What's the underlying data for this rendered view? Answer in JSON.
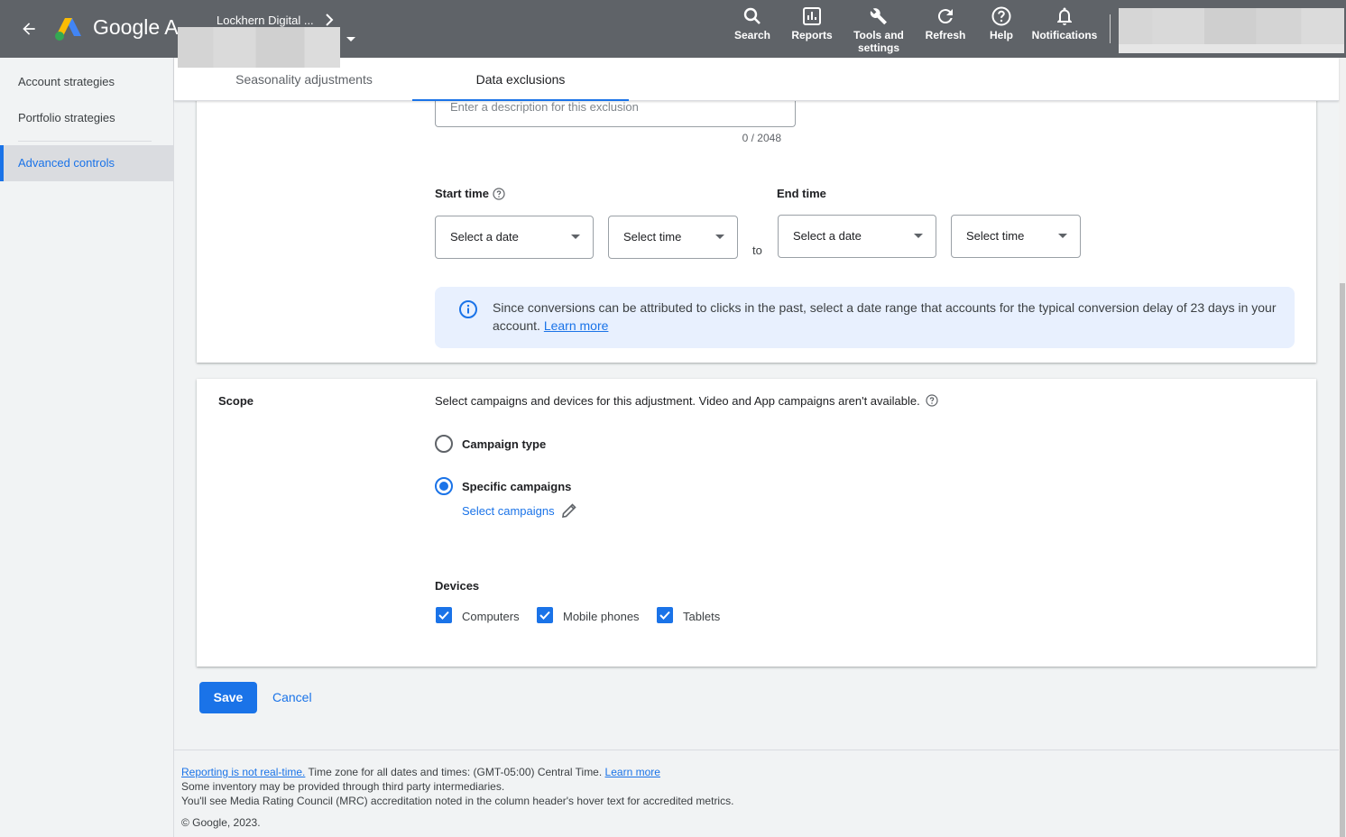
{
  "header": {
    "brand": "Google Ads",
    "account_name": "Lockhern Digital ...",
    "tools": [
      {
        "label": "Search",
        "icon": "search-icon"
      },
      {
        "label": "Reports",
        "icon": "reports-icon"
      },
      {
        "label": "Tools and settings",
        "icon": "wrench-icon"
      },
      {
        "label": "Refresh",
        "icon": "refresh-icon"
      },
      {
        "label": "Help",
        "icon": "help-icon"
      },
      {
        "label": "Notifications",
        "icon": "bell-icon"
      }
    ]
  },
  "sidebar": {
    "items": [
      {
        "label": "Account strategies"
      },
      {
        "label": "Portfolio strategies"
      },
      {
        "label": "Advanced controls"
      }
    ]
  },
  "tabs": [
    {
      "label": "Seasonality adjustments"
    },
    {
      "label": "Data exclusions"
    }
  ],
  "form": {
    "description_placeholder": "Enter a description for this exclusion",
    "char_count": "0 / 2048",
    "start_time_label": "Start time",
    "end_time_label": "End time",
    "start_date_placeholder": "Select a date",
    "start_time_placeholder": "Select time",
    "to_label": "to",
    "end_date_placeholder": "Select a date",
    "end_time_placeholder": "Select time",
    "info_text": "Since conversions can be attributed to clicks in the past, select a date range that accounts for the typical conversion delay of 23 days in your account.",
    "info_link": "Learn more"
  },
  "scope": {
    "label": "Scope",
    "description": "Select campaigns and devices for this adjustment. Video and App campaigns aren't available.",
    "option_campaign_type": "Campaign type",
    "option_specific_campaigns": "Specific campaigns",
    "selected_option": "Specific campaigns",
    "select_campaigns_link": "Select campaigns",
    "devices_label": "Devices",
    "devices": [
      {
        "label": "Computers",
        "checked": true
      },
      {
        "label": "Mobile phones",
        "checked": true
      },
      {
        "label": "Tablets",
        "checked": true
      }
    ]
  },
  "actions": {
    "save": "Save",
    "cancel": "Cancel"
  },
  "footer": {
    "reporting_link": "Reporting is not real-time.",
    "timezone_text": "Time zone for all dates and times: (GMT-05:00) Central Time.",
    "learn_more": "Learn more",
    "line2": "Some inventory may be provided through third party intermediaries.",
    "line3": "You'll see Media Rating Council (MRC) accreditation noted in the column header's hover text for accredited metrics.",
    "copyright": "© Google, 2023."
  },
  "colors": {
    "topbar": "#5f6368",
    "accent": "#1a73e8",
    "info_bg": "#e8f0fe"
  }
}
